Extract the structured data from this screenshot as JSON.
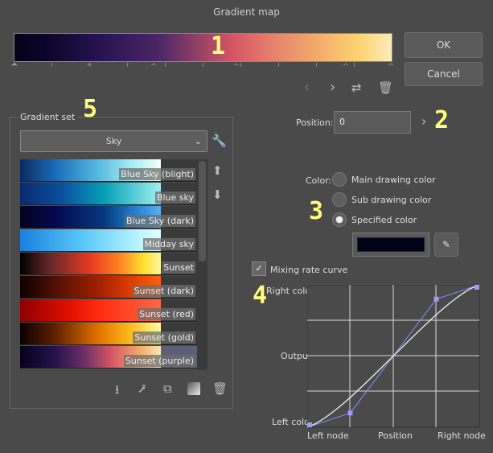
{
  "title": "Gradient map",
  "buttons": {
    "ok": "OK",
    "cancel": "Cancel"
  },
  "annotations": [
    "1",
    "2",
    "3",
    "4",
    "5"
  ],
  "position": {
    "label": "Position:",
    "value": "0"
  },
  "gradient_set": {
    "label": "Gradient set",
    "selected": "Sky",
    "items": [
      {
        "label": "Blue Sky (blight)",
        "gradient": "linear-gradient(to right,#0a2a60,#1a6cb8 25%,#55b8e0 55%,#a8eef5 80%,#f4fff8)"
      },
      {
        "label": "Blue sky",
        "gradient": "linear-gradient(to right,#0a2a70,#0a50a0 30%,#05a0b8 60%,#a0f0f0)"
      },
      {
        "label": "Blue Sky (dark)",
        "gradient": "linear-gradient(to right,#040320,#05084f 25%,#053a80 60%,#2a88d8 85%,#5ab0f0)"
      },
      {
        "label": "Midday sky",
        "gradient": "linear-gradient(to right,#1a80e0,#5ac8f8 45%,#b0f0ff 80%,#e0ffff)"
      },
      {
        "label": "Sunset",
        "gradient": "linear-gradient(to right,#000,#602628 20%,#e83a20 50%,#ff8020 70%,#ffe030 88%,#fff8a0)"
      },
      {
        "label": "Sunset (dark)",
        "gradient": "linear-gradient(to right,#100000,#501005 25%,#a02000 55%,#e04000 80%,#ff6010)"
      },
      {
        "label": "Sunset (red)",
        "gradient": "linear-gradient(to right,#900000,#e01000 35%,#ff2a10 55%,#ff6a40)"
      },
      {
        "label": "Sunset (gold)",
        "gradient": "linear-gradient(to right,#0a0000,#602000 25%,#e07000 55%,#ffc020 80%,#ffffa0)"
      },
      {
        "label": "Sunset (purple)",
        "gradient": "linear-gradient(to right,#05021a,#26124f 25%,#6a2e66 45%,#d65565 65%,#f2aa6b 85%,#fde8b0)"
      }
    ]
  },
  "color": {
    "label": "Color:",
    "options": [
      "Main drawing color",
      "Sub drawing color",
      "Specified color"
    ],
    "selected": 2,
    "specified_hex": "#020318"
  },
  "mixing_curve": {
    "label": "Mixing rate curve",
    "checked": true,
    "y_labels": {
      "top": "Right color",
      "mid": "Output",
      "bottom": "Left color"
    },
    "x_labels": {
      "left": "Left node",
      "mid": "Position",
      "right": "Right node"
    },
    "control_points": [
      [
        0,
        0
      ],
      [
        0.25,
        0.1
      ],
      [
        0.75,
        0.9
      ],
      [
        1,
        1
      ]
    ]
  },
  "gradient_nodes": [
    0,
    0.2,
    0.37,
    0.59,
    0.88,
    1.0
  ]
}
